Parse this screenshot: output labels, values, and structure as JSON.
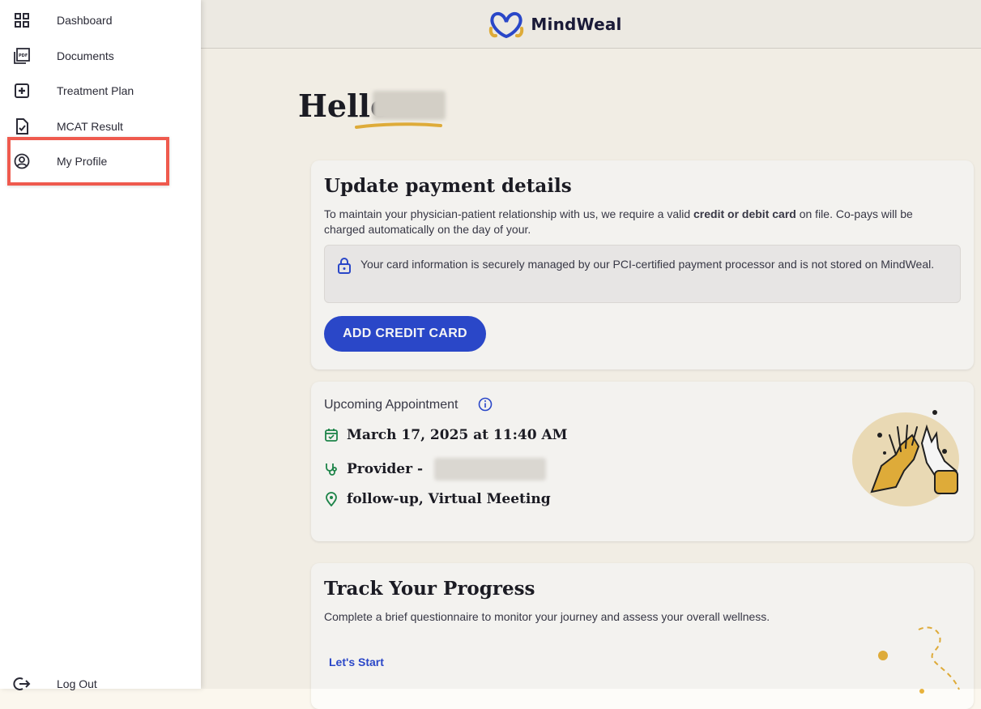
{
  "sidebar": {
    "items": [
      {
        "label": "Dashboard",
        "icon": "dashboard-grid-icon"
      },
      {
        "label": "Documents",
        "icon": "pdf-documents-icon"
      },
      {
        "label": "Treatment Plan",
        "icon": "plus-square-icon"
      },
      {
        "label": "MCAT Result",
        "icon": "clipboard-check-icon"
      },
      {
        "label": "My Profile",
        "icon": "user-circle-icon"
      }
    ],
    "logout_label": "Log Out"
  },
  "header": {
    "brand": "MindWeal"
  },
  "greeting": {
    "hello": "Hello"
  },
  "payment_card": {
    "title": "Update payment details",
    "desc_prefix": "To maintain your physician-patient relationship with us, we require a valid ",
    "desc_bold": "credit or debit card",
    "desc_suffix": " on file. Co-pays will be charged automatically on the day of your.",
    "secure_note": "Your card information is securely managed by our PCI-certified payment processor and is not stored on MindWeal.",
    "button_label": "ADD CREDIT CARD"
  },
  "appointment_card": {
    "label": "Upcoming Appointment",
    "datetime": "March 17, 2025 at 11:40 AM",
    "provider_prefix": "Provider -",
    "location": "follow-up, Virtual Meeting"
  },
  "progress_card": {
    "title": "Track Your Progress",
    "desc": "Complete a brief questionnaire to monitor your journey and assess your overall wellness.",
    "link_label": "Let's Start"
  },
  "colors": {
    "accent": "#2c4ad1",
    "highlight": "#ef5a4e",
    "gold": "#e8b23c",
    "green": "#1f8a4c"
  }
}
